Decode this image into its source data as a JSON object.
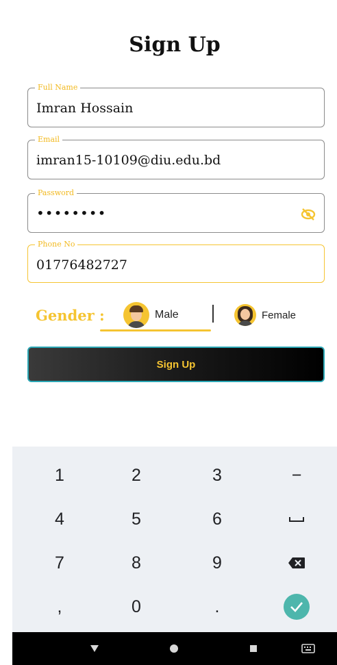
{
  "title": "Sign Up",
  "fields": {
    "full_name": {
      "label": "Full Name",
      "value": "Imran Hossain"
    },
    "email": {
      "label": "Email",
      "value": "imran15-10109@diu.edu.bd"
    },
    "password": {
      "label": "Password",
      "value": "••••••••",
      "toggle_icon": "eye-off-icon"
    },
    "phone": {
      "label": "Phone No",
      "value": "01776482727"
    }
  },
  "gender": {
    "label": "Gender :",
    "options": [
      {
        "label": "Male",
        "selected": true,
        "icon": "male-avatar-icon"
      },
      {
        "label": "Female",
        "selected": false,
        "icon": "female-avatar-icon"
      }
    ]
  },
  "signup_button": {
    "label": "Sign Up"
  },
  "keyboard": {
    "rows": [
      [
        "1",
        "2",
        "3",
        "−"
      ],
      [
        "4",
        "5",
        "6",
        "space"
      ],
      [
        "7",
        "8",
        "9",
        "backspace"
      ],
      [
        ",",
        "0",
        ".",
        "done"
      ]
    ]
  },
  "navbar": {
    "icons": [
      "back-icon",
      "home-icon",
      "recents-icon",
      "keyboard-switch-icon"
    ]
  },
  "colors": {
    "accent": "#f5c431",
    "button_border": "#2aa7b5",
    "done_key": "#4db6ac"
  }
}
